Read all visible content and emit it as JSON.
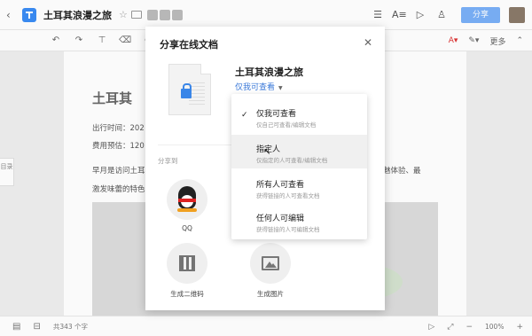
{
  "topbar": {
    "doc_title": "土耳其浪漫之旅",
    "share_label": "分享"
  },
  "toolbar": {
    "more_label": "更多"
  },
  "document": {
    "heading": "土耳其",
    "line1": "出行时间：202",
    "line2": "费用预估：120",
    "line3": "早月是访问土耳其的最佳时间，",
    "line4": "激发味蕾的特色",
    "line3_end": "魅体验、最",
    "side_tab": "目录"
  },
  "statusbar": {
    "word_count": "共343 个字",
    "zoom": "100%"
  },
  "share_dialog": {
    "title": "分享在线文档",
    "doc_name": "土耳其浪漫之旅",
    "permission_selected": "仅我可查看",
    "share_to_label": "分享到",
    "targets": [
      {
        "label": "QQ"
      },
      {
        "label": "生成二维码"
      },
      {
        "label": "生成图片"
      }
    ]
  },
  "permission_options": [
    {
      "title": "仅我可查看",
      "desc": "仅自己可查看/编辑文档",
      "selected": true
    },
    {
      "title": "指定人",
      "desc": "仅指定的人可查看/编辑文档",
      "selected": false
    },
    {
      "title": "所有人可查看",
      "desc": "获得链接的人可查看文档",
      "selected": false
    },
    {
      "title": "任何人可编辑",
      "desc": "获得链接的人可编辑文档",
      "selected": false
    }
  ],
  "colors": {
    "accent": "#3a78d8",
    "share_button": "#7ab0f7"
  }
}
